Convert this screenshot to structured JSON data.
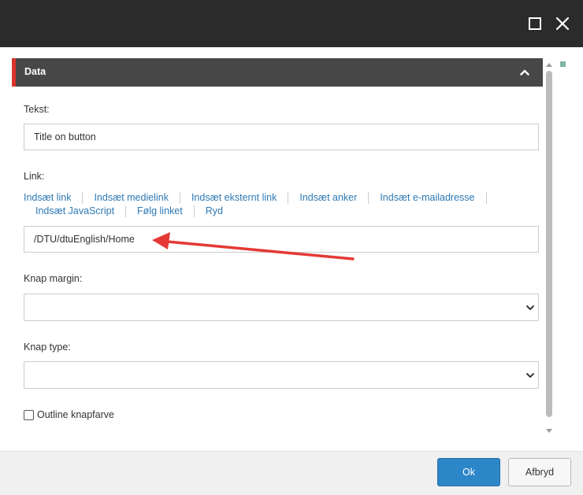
{
  "section": {
    "title": "Data"
  },
  "fields": {
    "tekst": {
      "label": "Tekst:",
      "value": "Title on button"
    },
    "link": {
      "label": "Link:",
      "value": "/DTU/dtuEnglish/Home",
      "actions_row1": [
        "Indsæt link",
        "Indsæt medielink",
        "Indsæt eksternt link",
        "Indsæt anker",
        "Indsæt e-mailadresse"
      ],
      "actions_row2": [
        "Indsæt JavaScript",
        "Følg linket",
        "Ryd"
      ]
    },
    "knap_margin": {
      "label": "Knap margin:",
      "value": ""
    },
    "knap_type": {
      "label": "Knap type:",
      "value": ""
    },
    "outline": {
      "label": "Outline knapfarve",
      "checked": false
    }
  },
  "footer": {
    "ok_label": "Ok",
    "cancel_label": "Afbryd"
  },
  "colors": {
    "accent": "#d9332b",
    "link": "#2d79b4",
    "primary_button": "#2d86c8",
    "annotation_arrow": "#e53935"
  },
  "icons": {
    "maximize": "maximize-icon",
    "close": "close-icon",
    "collapse": "chevron-up-icon",
    "select": "chevron-down-icon",
    "annotation": "red-arrow-annotation-icon"
  }
}
